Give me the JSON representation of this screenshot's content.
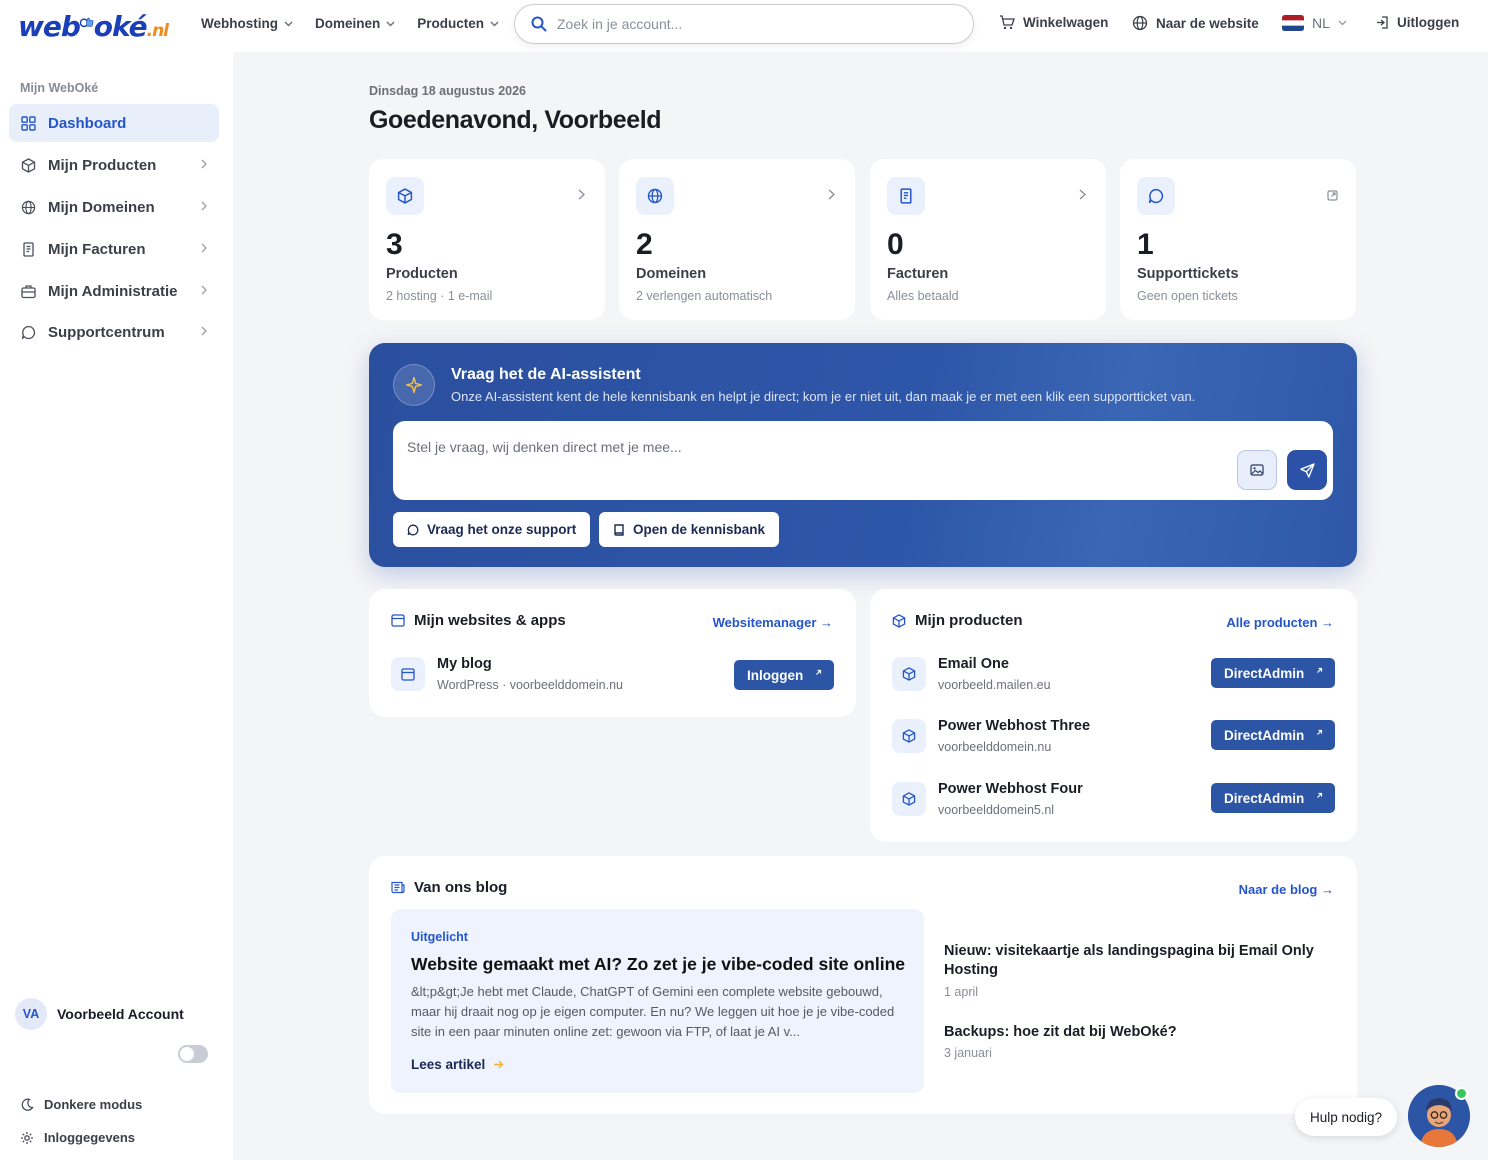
{
  "brand": {
    "logo_main": "web",
    "logo_mid": "oké",
    "logo_tld": ".nl",
    "accent": "#2456c9",
    "brand_blue": "#2c55a6"
  },
  "topnav": {
    "items": [
      {
        "label": "Webhosting",
        "icon": "chevron-down-icon"
      },
      {
        "label": "Domeinen",
        "icon": "chevron-down-icon"
      },
      {
        "label": "Producten",
        "icon": "chevron-down-icon"
      }
    ],
    "search_placeholder": "Zoek in je account...",
    "cart": "Winkelwagen",
    "website": "Naar de website",
    "language": "NL",
    "logout": "Uitloggen"
  },
  "sidebar": {
    "heading": "Mijn WebOké",
    "items": [
      {
        "label": "Dashboard",
        "icon": "grid-icon",
        "active": true
      },
      {
        "label": "Mijn Producten",
        "icon": "cube-icon"
      },
      {
        "label": "Mijn Domeinen",
        "icon": "globe-icon"
      },
      {
        "label": "Mijn Facturen",
        "icon": "receipt-icon"
      },
      {
        "label": "Mijn Administratie",
        "icon": "briefcase-icon"
      },
      {
        "label": "Supportcentrum",
        "icon": "chat-icon"
      }
    ],
    "account_initials": "VA",
    "account_name": "Voorbeeld Account",
    "dark_mode": "Donkere modus",
    "dark_mode_on": false,
    "login_details": "Inloggegevens"
  },
  "header": {
    "date": "Dinsdag 18 augustus 2026",
    "greeting": "Goedenavond, Voorbeeld"
  },
  "stats": [
    {
      "value": "3",
      "label": "Producten",
      "sub": "2 hosting · 1 e-mail",
      "icon": "cube-icon"
    },
    {
      "value": "2",
      "label": "Domeinen",
      "sub": "2 verlengen automatisch",
      "icon": "globe-icon"
    },
    {
      "value": "0",
      "label": "Facturen",
      "sub": "Alles betaald",
      "icon": "receipt-icon"
    },
    {
      "value": "1",
      "label": "Supporttickets",
      "sub": "Geen open tickets",
      "icon": "chat-icon"
    }
  ],
  "ai": {
    "title": "Vraag het de AI-assistent",
    "subtitle": "Onze AI-assistent kent de hele kennisbank en helpt je direct; kom je er niet uit, dan maak je er met een klik een supportticket van.",
    "placeholder": "Stel je vraag, wij denken direct met je mee...",
    "support_button": "Vraag het onze support",
    "kb_button": "Open de kennisbank"
  },
  "websites": {
    "title": "Mijn websites & apps",
    "link": "Websitemanager →",
    "items": [
      {
        "name": "My blog",
        "detail": "WordPress · voorbeelddomein.nu",
        "button": "Inloggen"
      }
    ]
  },
  "products": {
    "title": "Mijn producten",
    "link": "Alle producten →",
    "items": [
      {
        "name": "Email One",
        "detail": "voorbeeld.mailen.eu",
        "button": "DirectAdmin"
      },
      {
        "name": "Power Webhost Three",
        "detail": "voorbeelddomein.nu",
        "button": "DirectAdmin"
      },
      {
        "name": "Power Webhost Four",
        "detail": "voorbeelddomein5.nl",
        "button": "DirectAdmin"
      }
    ]
  },
  "blog": {
    "title": "Van ons blog",
    "link": "Naar de blog →",
    "featured": {
      "tag": "Uitgelicht",
      "title": "Website gemaakt met AI? Zo zet je je vibe-coded site online",
      "excerpt": "&lt;p&gt;Je hebt met Claude, ChatGPT of Gemini een complete website gebouwd, maar hij draait nog op je eigen computer. En nu? We leggen uit hoe je je vibe-coded site in een paar minuten online zet: gewoon via FTP, of laat je AI v...",
      "read_more": "Lees artikel"
    },
    "posts": [
      {
        "title": "Nieuw: visitekaartje als landingspagina bij Email Only Hosting",
        "date": "1 april"
      },
      {
        "title": "Backups: hoe zit dat bij WebOké?",
        "date": "3 januari"
      }
    ]
  },
  "help": {
    "bubble": "Hulp nodig?"
  }
}
